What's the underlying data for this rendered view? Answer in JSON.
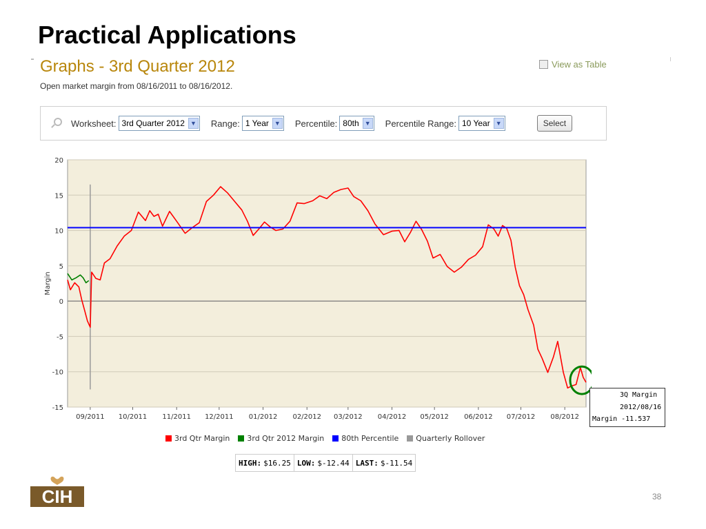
{
  "slide": {
    "title": "Practical Applications",
    "page_number": "38"
  },
  "heading": "Graphs - 3rd Quarter 2012",
  "subtitle": "Open market margin from 08/16/2011 to 08/16/2012.",
  "view_as_table": "View as Table",
  "toolbar": {
    "worksheet_label": "Worksheet:",
    "worksheet_value": "3rd Quarter 2012",
    "range_label": "Range:",
    "range_value": "1 Year",
    "percentile_label": "Percentile:",
    "percentile_value": "80th",
    "percentile_range_label": "Percentile Range:",
    "percentile_range_value": "10 Year",
    "select_button": "Select"
  },
  "stats": {
    "high_label": "HIGH:",
    "high": "$16.25",
    "low_label": "LOW:",
    "low": "$-12.44",
    "last_label": "LAST:",
    "last": "$-11.54"
  },
  "tooltip": {
    "line1": "3Q Margin",
    "line2": "2012/08/16",
    "line3": "Margin -11.537"
  },
  "logo": {
    "text": "CIH"
  },
  "colors": {
    "red": "#ff0000",
    "green": "#008000",
    "blue": "#0000ff",
    "gray": "#999999",
    "plot_bg": "#f3eedc",
    "gold": "#b8860b"
  },
  "chart_data": {
    "type": "line",
    "ylabel": "Margin",
    "ylim": [
      -15,
      20
    ],
    "yticks": [
      -15,
      -10,
      -5,
      0,
      5,
      10,
      15,
      20
    ],
    "x_tick_labels": [
      "09/2011",
      "10/2011",
      "11/2011",
      "12/2011",
      "01/2012",
      "02/2012",
      "03/2012",
      "04/2012",
      "05/2012",
      "06/2012",
      "07/2012",
      "08/2012"
    ],
    "x_range": [
      "2011-08-16",
      "2012-08-16"
    ],
    "legend": [
      "3rd Qtr Margin",
      "3rd Qtr 2012 Margin",
      "80th Percentile",
      "Quarterly Rollover"
    ],
    "series": [
      {
        "name": "3rd Qtr Margin",
        "color": "#ff0000",
        "points": [
          [
            "2011-08-16",
            3.0
          ],
          [
            "2011-08-18",
            1.6
          ],
          [
            "2011-08-21",
            2.6
          ],
          [
            "2011-08-24",
            2.0
          ],
          [
            "2011-08-26",
            0.2
          ],
          [
            "2011-08-28",
            -1.3
          ],
          [
            "2011-08-30",
            -2.8
          ],
          [
            "2011-09-01",
            -3.7
          ],
          [
            "2011-09-02",
            4.1
          ],
          [
            "2011-09-05",
            3.2
          ],
          [
            "2011-09-08",
            3.0
          ],
          [
            "2011-09-11",
            5.4
          ],
          [
            "2011-09-15",
            6.0
          ],
          [
            "2011-09-20",
            7.8
          ],
          [
            "2011-09-25",
            9.2
          ],
          [
            "2011-09-30",
            10.0
          ],
          [
            "2011-10-05",
            12.6
          ],
          [
            "2011-10-10",
            11.4
          ],
          [
            "2011-10-13",
            12.8
          ],
          [
            "2011-10-16",
            12.0
          ],
          [
            "2011-10-19",
            12.3
          ],
          [
            "2011-10-22",
            10.6
          ],
          [
            "2011-10-27",
            12.7
          ],
          [
            "2011-11-01",
            11.3
          ],
          [
            "2011-11-07",
            9.6
          ],
          [
            "2011-11-12",
            10.4
          ],
          [
            "2011-11-17",
            11.1
          ],
          [
            "2011-11-22",
            14.1
          ],
          [
            "2011-11-27",
            15.0
          ],
          [
            "2011-12-02",
            16.2
          ],
          [
            "2011-12-07",
            15.3
          ],
          [
            "2011-12-12",
            14.1
          ],
          [
            "2011-12-17",
            12.9
          ],
          [
            "2011-12-21",
            11.3
          ],
          [
            "2011-12-25",
            9.3
          ],
          [
            "2011-12-29",
            10.2
          ],
          [
            "2012-01-02",
            11.2
          ],
          [
            "2012-01-06",
            10.5
          ],
          [
            "2012-01-10",
            10.0
          ],
          [
            "2012-01-15",
            10.2
          ],
          [
            "2012-01-20",
            11.3
          ],
          [
            "2012-01-25",
            13.9
          ],
          [
            "2012-01-30",
            13.8
          ],
          [
            "2012-02-05",
            14.2
          ],
          [
            "2012-02-10",
            14.9
          ],
          [
            "2012-02-15",
            14.5
          ],
          [
            "2012-02-20",
            15.4
          ],
          [
            "2012-02-25",
            15.8
          ],
          [
            "2012-03-01",
            16.0
          ],
          [
            "2012-03-05",
            14.8
          ],
          [
            "2012-03-10",
            14.2
          ],
          [
            "2012-03-15",
            12.8
          ],
          [
            "2012-03-20",
            10.9
          ],
          [
            "2012-03-26",
            9.4
          ],
          [
            "2012-04-01",
            9.9
          ],
          [
            "2012-04-06",
            10.0
          ],
          [
            "2012-04-10",
            8.4
          ],
          [
            "2012-04-14",
            9.7
          ],
          [
            "2012-04-18",
            11.3
          ],
          [
            "2012-04-22",
            10.1
          ],
          [
            "2012-04-26",
            8.5
          ],
          [
            "2012-04-30",
            6.1
          ],
          [
            "2012-05-05",
            6.6
          ],
          [
            "2012-05-10",
            4.9
          ],
          [
            "2012-05-15",
            4.1
          ],
          [
            "2012-05-20",
            4.8
          ],
          [
            "2012-05-25",
            5.9
          ],
          [
            "2012-05-30",
            6.5
          ],
          [
            "2012-06-04",
            7.7
          ],
          [
            "2012-06-08",
            10.8
          ],
          [
            "2012-06-12",
            10.2
          ],
          [
            "2012-06-15",
            9.2
          ],
          [
            "2012-06-18",
            10.7
          ],
          [
            "2012-06-21",
            10.3
          ],
          [
            "2012-06-24",
            8.6
          ],
          [
            "2012-06-27",
            4.8
          ],
          [
            "2012-06-30",
            2.2
          ],
          [
            "2012-07-03",
            0.9
          ],
          [
            "2012-07-06",
            -1.2
          ],
          [
            "2012-07-10",
            -3.4
          ],
          [
            "2012-07-13",
            -6.8
          ],
          [
            "2012-07-16",
            -8.1
          ],
          [
            "2012-07-20",
            -10.1
          ],
          [
            "2012-07-24",
            -7.9
          ],
          [
            "2012-07-27",
            -5.7
          ],
          [
            "2012-07-31",
            -10.1
          ],
          [
            "2012-08-03",
            -12.3
          ],
          [
            "2012-08-06",
            -12.0
          ],
          [
            "2012-08-09",
            -11.8
          ],
          [
            "2012-08-12",
            -9.4
          ],
          [
            "2012-08-14",
            -10.8
          ],
          [
            "2012-08-16",
            -11.5
          ]
        ]
      },
      {
        "name": "3rd Qtr 2012 Margin",
        "color": "#008000",
        "points": [
          [
            "2011-08-16",
            3.9
          ],
          [
            "2011-08-19",
            3.0
          ],
          [
            "2011-08-22",
            3.3
          ],
          [
            "2011-08-25",
            3.7
          ],
          [
            "2011-08-27",
            3.3
          ],
          [
            "2011-08-29",
            2.6
          ],
          [
            "2011-08-31",
            2.9
          ]
        ]
      },
      {
        "name": "80th Percentile",
        "color": "#0000ff",
        "points": [
          [
            "2011-08-16",
            10.4
          ],
          [
            "2012-08-16",
            10.4
          ]
        ]
      }
    ],
    "rollover": {
      "date": "2011-09-01",
      "ymin": -12.5,
      "ymax": 16.5,
      "color": "#999999"
    }
  }
}
